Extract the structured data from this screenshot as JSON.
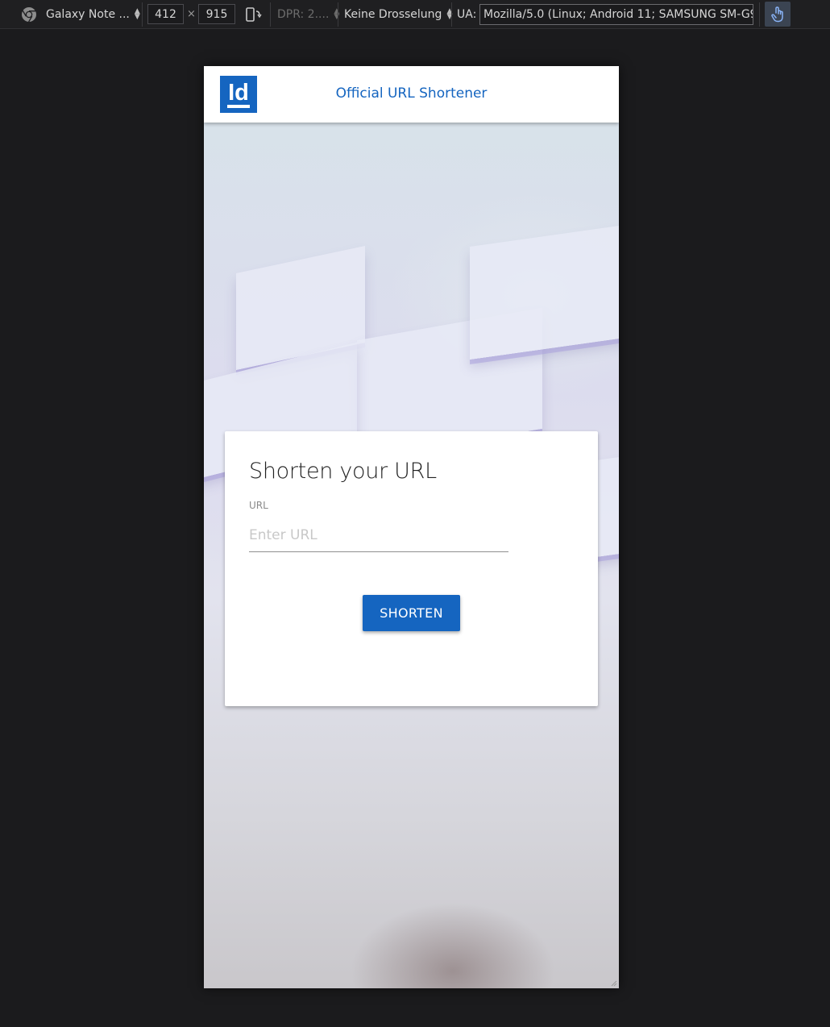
{
  "devtools": {
    "device_name": "Galaxy Note ...",
    "width": "412",
    "times": "×",
    "height": "915",
    "dpr": "DPR: 2....",
    "throttle": "Keine Drosselung",
    "ua_label": "UA:",
    "ua_value": "Mozilla/5.0 (Linux; Android 11; SAMSUNG SM-G97",
    "icons": [
      "chrome-icon",
      "rotate-icon",
      "touch-icon"
    ]
  },
  "app": {
    "logo_text": "Id",
    "title": "Official URL Shortener",
    "brand_color": "#1565c0"
  },
  "form": {
    "heading": "Shorten your URL",
    "url_label": "URL",
    "url_placeholder": "Enter URL",
    "url_value": "",
    "submit_label": "SHORTEN"
  }
}
